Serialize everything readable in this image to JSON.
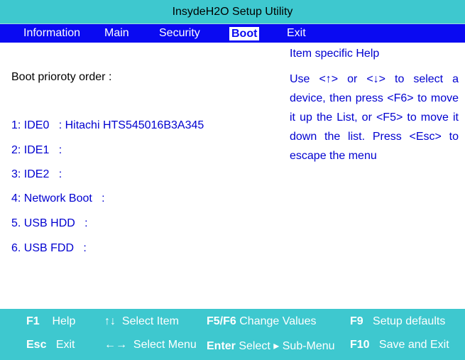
{
  "title": "InsydeH2O Setup Utility",
  "menu": {
    "items": [
      "Information",
      "Main",
      "Security",
      "Boot",
      "Exit"
    ],
    "active": "Boot"
  },
  "boot": {
    "heading": "Boot prioroty order :",
    "items": [
      {
        "label": "1: IDE0   : Hitachi HTS545016B3A345"
      },
      {
        "label": "2: IDE1   :"
      },
      {
        "label": "3: IDE2   :"
      },
      {
        "label": "4: Network Boot   :"
      },
      {
        "label": "5. USB HDD   :"
      },
      {
        "label": "6. USB FDD   :"
      }
    ]
  },
  "help": {
    "title": "Item specific Help",
    "text": "Use <↑> or <↓> to select a device, then press <F6> to move it up the List, or <F5> to move it down the list. Press <Esc> to escape the menu"
  },
  "footer": {
    "row1": [
      {
        "key": "F1",
        "desc": "Help"
      },
      {
        "key": "↑↓",
        "desc": "Select Item"
      },
      {
        "key": "F5/F6",
        "desc": "Change Values"
      },
      {
        "key": "F9",
        "desc": "Setup defaults"
      }
    ],
    "row2": [
      {
        "key": "Esc",
        "desc": "Exit"
      },
      {
        "key": "←→",
        "desc": "Select Menu"
      },
      {
        "key": "Enter",
        "desc": "Select ▸ Sub-Menu"
      },
      {
        "key": "F10",
        "desc": "Save and Exit"
      }
    ]
  },
  "colors": {
    "title_bg": "#3ec8cf",
    "menu_bg": "#0a0af2",
    "text_blue": "#0000d0",
    "footer_bg": "#3ec8cf"
  }
}
